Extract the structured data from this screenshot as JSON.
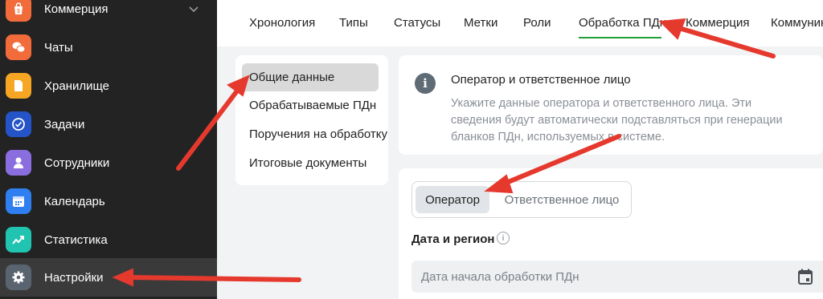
{
  "sidebar": {
    "items": [
      {
        "label": "Коммерция",
        "icon": "shopping-bag-icon",
        "color": "#f26b3a"
      },
      {
        "label": "Чаты",
        "icon": "chat-bubbles-icon",
        "color": "#f26b3a"
      },
      {
        "label": "Хранилище",
        "icon": "document-icon",
        "color": "#f6a623"
      },
      {
        "label": "Задачи",
        "icon": "check-circle-icon",
        "color": "#2454c8"
      },
      {
        "label": "Сотрудники",
        "icon": "person-icon",
        "color": "#8a6ee0"
      },
      {
        "label": "Календарь",
        "icon": "calendar-icon",
        "color": "#2f7ff0"
      },
      {
        "label": "Статистика",
        "icon": "trend-chart-icon",
        "color": "#21c4b0"
      },
      {
        "label": "Настройки",
        "icon": "gear-icon",
        "color": "#5a6470"
      }
    ],
    "active_index": 7
  },
  "tabs": {
    "items": [
      "Хронология",
      "Типы",
      "Статусы",
      "Метки",
      "Роли",
      "Обработка ПДн",
      "Коммерция",
      "Коммуникации"
    ],
    "active_index": 5,
    "accent": "#21a038"
  },
  "subnav": {
    "items": [
      "Общие данные",
      "Обрабатываемые ПДн",
      "Поручения на обработку",
      "Итоговые документы"
    ],
    "active_index": 0
  },
  "info": {
    "icon": "info-icon",
    "title": "Оператор и ответственное лицо",
    "text": "Укажите данные оператора и ответственного лица. Эти сведения будут автоматически подставляться при генерации бланков ПДн, используемых в системе."
  },
  "form": {
    "segments": [
      "Оператор",
      "Ответственное лицо"
    ],
    "active_segment": 0,
    "section_title": "Дата и регион",
    "date_placeholder": "Дата начала обработки ПДн"
  },
  "annotation_color": "#e5392e"
}
